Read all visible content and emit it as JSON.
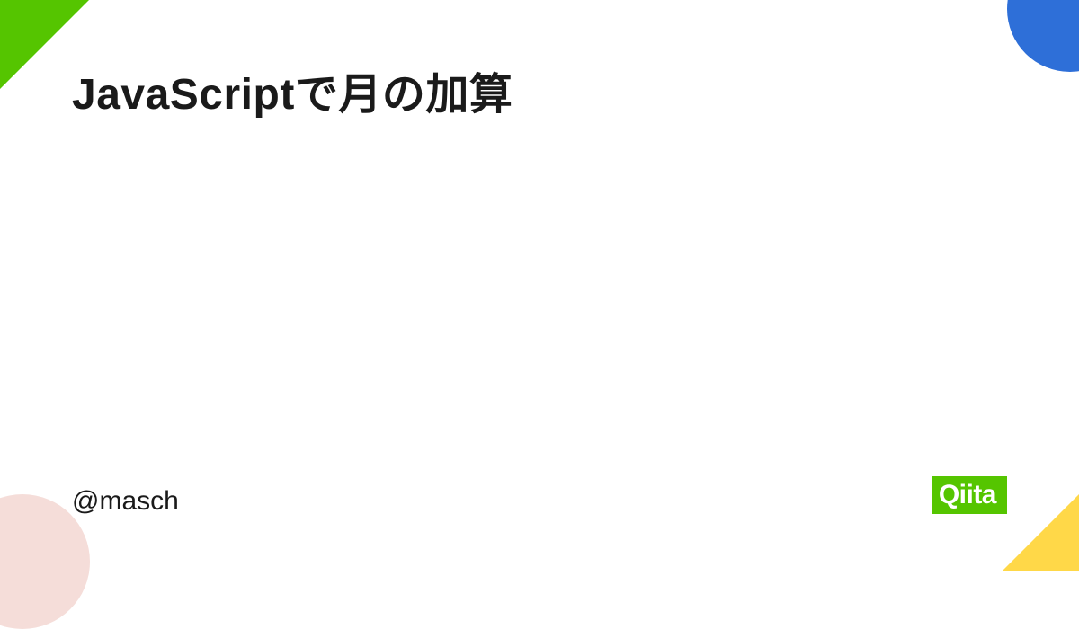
{
  "title": "JavaScriptで月の加算",
  "author": "@masch",
  "logo": "Qiita",
  "colors": {
    "brand": "#55c500",
    "accent_blue": "#2e6fd8",
    "accent_pink": "#f5ddd9",
    "accent_yellow": "#ffd848"
  }
}
